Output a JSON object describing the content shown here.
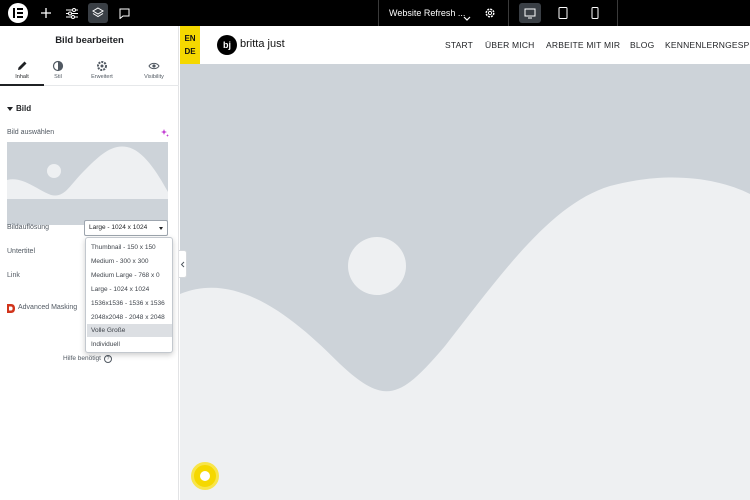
{
  "topbar": {
    "document_title": "Website Refresh ...",
    "icons": [
      "elementor-logo-icon",
      "add-element-icon",
      "settings-sliders-icon",
      "layers-icon",
      "comments-icon",
      "chevron-down-icon",
      "gear-icon",
      "desktop-icon",
      "tablet-icon",
      "mobile-icon"
    ]
  },
  "panel": {
    "title": "Bild bearbeiten",
    "tabs": [
      {
        "label": "Inhalt",
        "icon": "pencil-icon"
      },
      {
        "label": "Stil",
        "icon": "half-circle-icon"
      },
      {
        "label": "Erweitert",
        "icon": "gear-icon"
      },
      {
        "label": "Visibility",
        "icon": "eye-icon"
      }
    ],
    "section_title": "Bild",
    "choose_image_label": "Bild auswählen",
    "resolution_label": "Bildauflösung",
    "resolution_value": "Large - 1024 x 1024",
    "caption_label": "Untertitel",
    "link_label": "Link",
    "advanced_masking_label": "Advanced Masking",
    "help_text": "Hilfe benötigt",
    "resolution_options": [
      "Thumbnail - 150 x 150",
      "Medium - 300 x 300",
      "Medium Large - 768 x 0",
      "Large - 1024 x 1024",
      "1536x1536 - 1536 x 1536",
      "2048x2048 - 2048 x 2048",
      "Volle Große",
      "Individuell"
    ],
    "highlighted_option": "Volle Große"
  },
  "site": {
    "lang": [
      "EN",
      "DE"
    ],
    "logo_mark": "bj",
    "brand_name": "britta just",
    "nav": [
      "START",
      "ÜBER MICH",
      "ARBEITE MIT MIR",
      "BLOG",
      "KENNENLERNGESPR"
    ]
  },
  "colors": {
    "topbar": "#000000",
    "placeholder_bg": "#cdd3d9",
    "placeholder_shape": "#eef0f2",
    "accent_yellow": "#f5d800",
    "ai_sparkle": "#c036d1",
    "masking_icon": "#d1341b"
  }
}
